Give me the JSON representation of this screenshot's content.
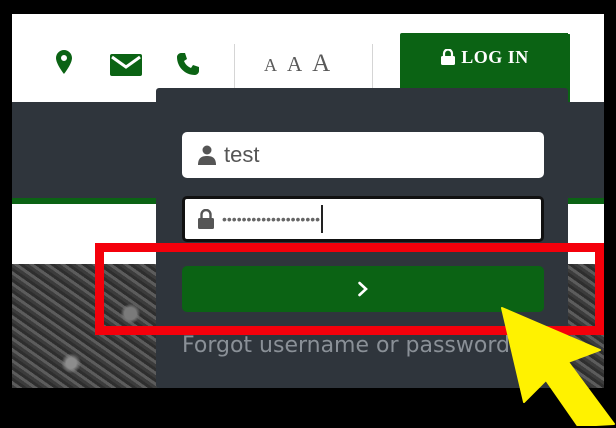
{
  "topbar": {
    "icons": [
      "map-marker-icon",
      "envelope-icon",
      "phone-icon"
    ],
    "font_size_labels": [
      "A",
      "A",
      "A"
    ],
    "login_tab_label": "LOG IN"
  },
  "login_form": {
    "username_value": "test",
    "password_masked": "••••••••••••••••••••",
    "submit_icon": "chevron-right-icon",
    "forgot_link": "Forgot username or password?"
  },
  "annotations": {
    "highlight_color": "#f4000b",
    "arrow_color": "#fff200"
  },
  "colors": {
    "brand_green": "#0b6314",
    "dark_panel": "#2f353c"
  }
}
